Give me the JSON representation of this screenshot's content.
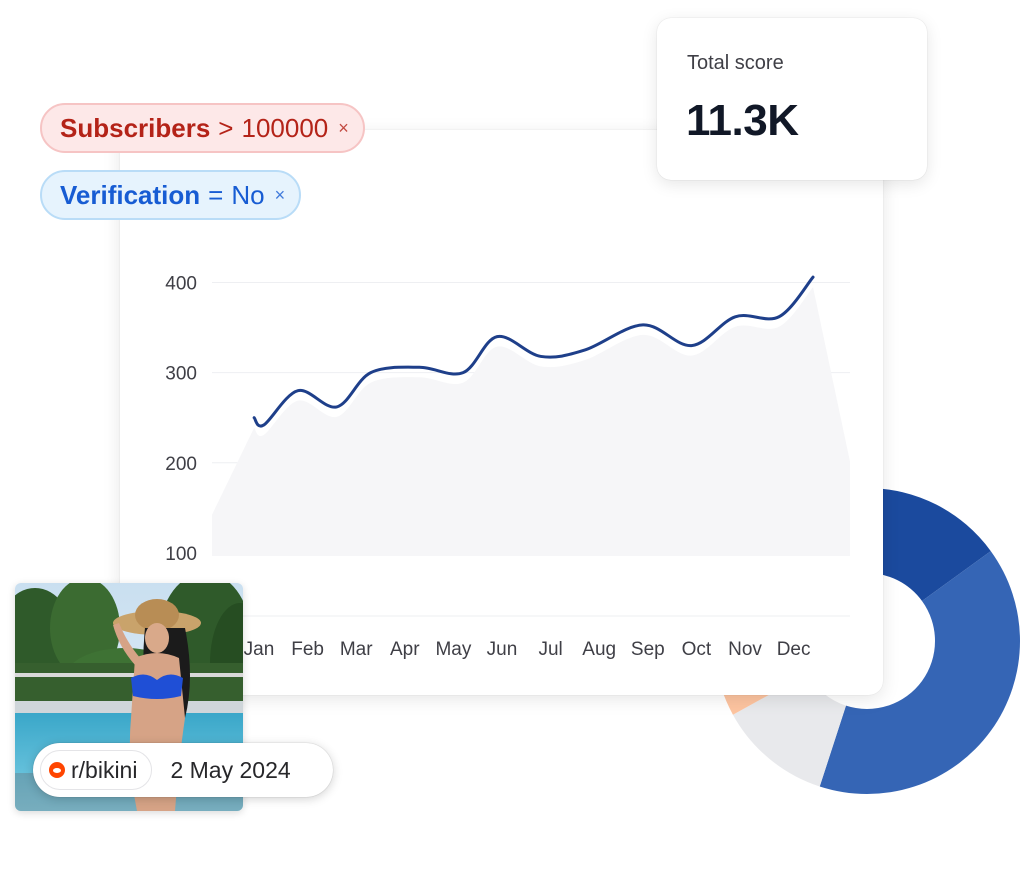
{
  "filters": [
    {
      "key": "Subscribers",
      "operator": ">",
      "value": "100000",
      "remove": "×",
      "color": "#b42318"
    },
    {
      "key": "Verification",
      "operator": "=",
      "value": "No",
      "remove": "×",
      "color": "#175cd3"
    }
  ],
  "score": {
    "label": "Total score",
    "value": "11.3K"
  },
  "post": {
    "subreddit": "r/bikini",
    "date": "2 May 2024",
    "icon": "reddit-icon"
  },
  "chart_data": {
    "type": "area",
    "x": [
      "Jan",
      "Feb",
      "Mar",
      "Apr",
      "May",
      "Jun",
      "Jul",
      "Aug",
      "Sep",
      "Oct",
      "Nov",
      "Dec"
    ],
    "y_ticks": [
      "100",
      "200",
      "300",
      "400"
    ],
    "ylim": [
      30,
      415
    ],
    "line_color": "#1e3f8a",
    "series": [
      {
        "values": [
          250,
          242,
          280,
          262,
          300,
          306,
          300,
          340,
          318,
          325,
          353,
          330,
          362,
          362,
          406
        ],
        "xpos": [
          -0.1,
          0.1,
          0.8,
          1.6,
          2.3,
          3.3,
          4.2,
          4.9,
          5.8,
          6.7,
          7.9,
          8.9,
          9.8,
          10.7,
          11.4
        ]
      }
    ]
  },
  "donut_data": {
    "type": "pie",
    "slices": [
      {
        "value": 15,
        "color": "#1b4a9e"
      },
      {
        "value": 40,
        "color": "#3565b5"
      },
      {
        "value": 12,
        "color": "#e8e9ec"
      },
      {
        "value": 6,
        "color": "#fdc4a0"
      },
      {
        "value": 27,
        "color": "#ffffff"
      }
    ]
  }
}
